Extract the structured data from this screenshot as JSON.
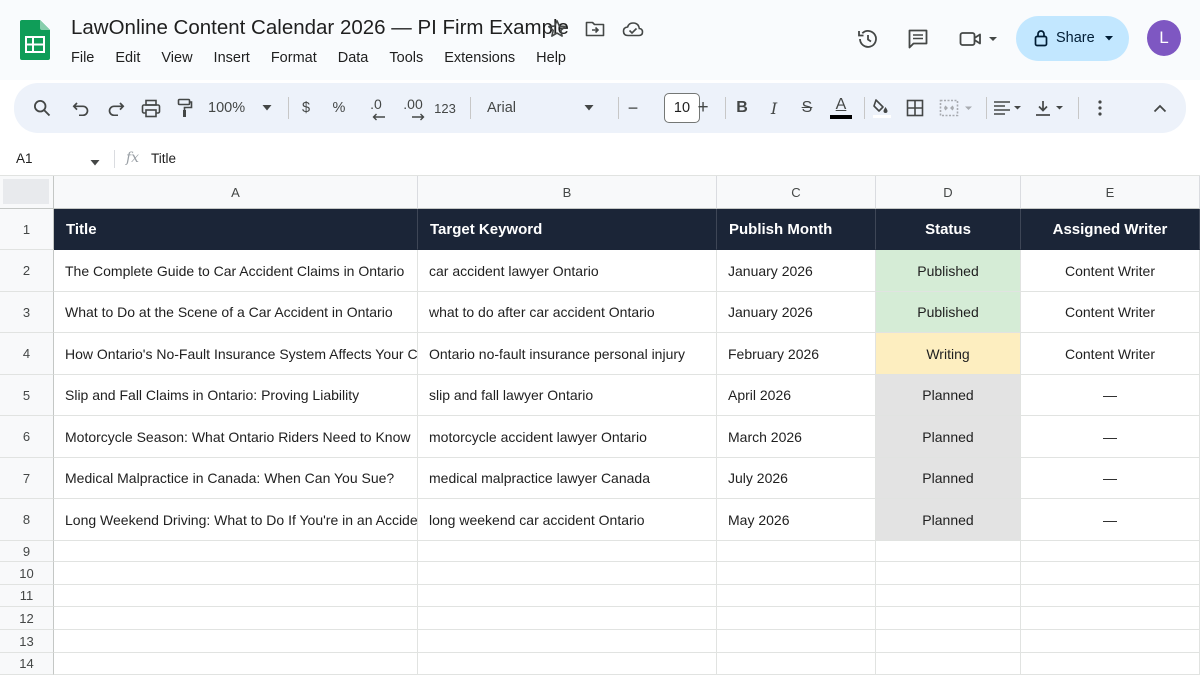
{
  "app": {
    "doc_title": "LawOnline Content Calendar 2026 — PI Firm Example",
    "menu": [
      "File",
      "Edit",
      "View",
      "Insert",
      "Format",
      "Data",
      "Tools",
      "Extensions",
      "Help"
    ],
    "share_label": "Share",
    "avatar_letter": "L",
    "colors": {
      "logo": "#0f9d58",
      "share_bg": "#c2e7ff",
      "avatar": "#7e57c2"
    }
  },
  "toolbar": {
    "zoom": "100%",
    "currency": "$",
    "percent": "%",
    "decrease_decimal": ".0",
    "increase_decimal": ".00",
    "number_format": "123",
    "font_family": "Arial",
    "font_size": "10",
    "minus": "−",
    "plus": "+",
    "bold": "B",
    "italic": "I",
    "strike": "S",
    "text_color": "A"
  },
  "formula_bar": {
    "cell_ref": "A1",
    "fx": "fx",
    "value": "Title"
  },
  "sheet": {
    "column_letters": [
      "A",
      "B",
      "C",
      "D",
      "E"
    ],
    "row_numbers": [
      "1",
      "2",
      "3",
      "4",
      "5",
      "6",
      "7",
      "8",
      "9",
      "10",
      "11",
      "12",
      "13",
      "14"
    ],
    "headers": [
      "Title",
      "Target Keyword",
      "Publish Month",
      "Status",
      "Assigned Writer"
    ],
    "rows": [
      [
        "The Complete Guide to Car Accident Claims in Ontario",
        "car accident lawyer Ontario",
        "January 2026",
        "Published",
        "Content Writer"
      ],
      [
        "What to Do at the Scene of a Car Accident in Ontario",
        "what to do after car accident Ontario",
        "January 2026",
        "Published",
        "Content Writer"
      ],
      [
        "How Ontario's No-Fault Insurance System Affects Your Claim",
        "Ontario no-fault insurance personal injury",
        "February 2026",
        "Writing",
        "Content Writer"
      ],
      [
        "Slip and Fall Claims in Ontario: Proving Liability",
        "slip and fall lawyer Ontario",
        "April 2026",
        "Planned",
        "—"
      ],
      [
        "Motorcycle Season: What Ontario Riders Need to Know",
        "motorcycle accident lawyer Ontario",
        "March 2026",
        "Planned",
        "—"
      ],
      [
        "Medical Malpractice in Canada: When Can You Sue?",
        "medical malpractice lawyer Canada",
        "July 2026",
        "Planned",
        "—"
      ],
      [
        "Long Weekend Driving: What to Do If You're in an Accident",
        "long weekend car accident Ontario",
        "May 2026",
        "Planned",
        "—"
      ]
    ],
    "colors": {
      "header_bg": "#1b2537",
      "status_published": "#d5ecd6",
      "status_writing": "#fdeec0",
      "status_planned": "#e3e3e3"
    }
  }
}
